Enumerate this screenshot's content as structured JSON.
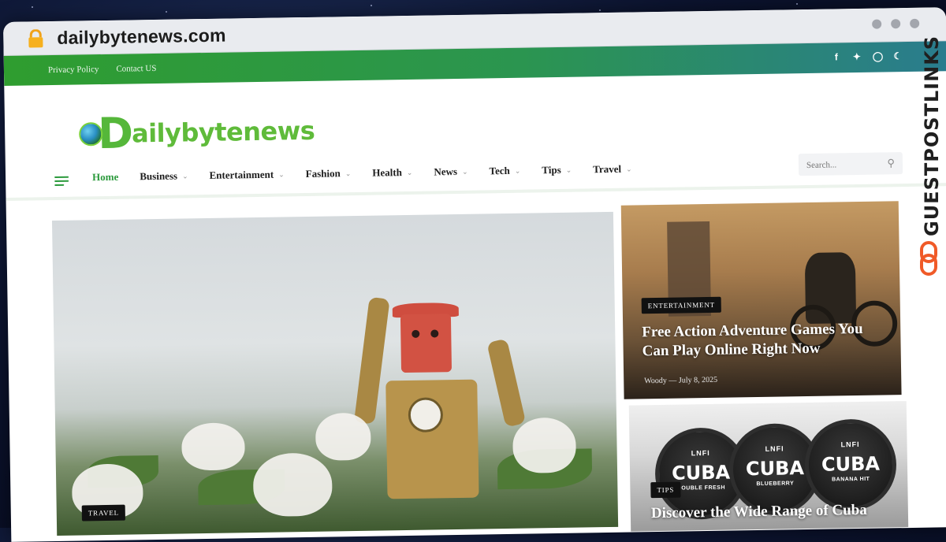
{
  "browser": {
    "url": "dailybytenews.com"
  },
  "topbar": {
    "links": [
      "Privacy Policy",
      "Contact US"
    ],
    "social_icons": [
      "facebook-icon",
      "twitter-icon",
      "instagram-icon",
      "moon-icon"
    ]
  },
  "site": {
    "logo_first_letter": "D",
    "logo_rest": "ailybytenews"
  },
  "nav": {
    "items": [
      {
        "label": "Home",
        "active": true,
        "dropdown": false
      },
      {
        "label": "Business",
        "dropdown": true
      },
      {
        "label": "Entertainment",
        "dropdown": true
      },
      {
        "label": "Fashion",
        "dropdown": true
      },
      {
        "label": "Health",
        "dropdown": true
      },
      {
        "label": "News",
        "dropdown": true
      },
      {
        "label": "Tech",
        "dropdown": true
      },
      {
        "label": "Tips",
        "dropdown": true
      },
      {
        "label": "Travel",
        "dropdown": true
      }
    ],
    "search_placeholder": "Search..."
  },
  "hero": {
    "category": "TRAVEL"
  },
  "cards": [
    {
      "category": "ENTERTAINMENT",
      "title": "Free Action Adventure Games You Can Play Online Right Now",
      "author": "Woody",
      "date": "July 8, 2025"
    },
    {
      "category": "TIPS",
      "title": "Discover the Wide Range of Cuba",
      "tins": [
        {
          "brand": "LNFI",
          "name": "CUBA",
          "flavor": "DOUBLE FRESH"
        },
        {
          "brand": "LNFI",
          "name": "CUBA",
          "flavor": "BLUEBERRY"
        },
        {
          "brand": "LNFI",
          "name": "CUBA",
          "flavor": "BANANA HIT"
        }
      ]
    }
  ],
  "watermark": {
    "text": "GUESTPOSTLINKS"
  },
  "colors": {
    "brand_green": "#2b9a3c",
    "topbar_gradient_start": "#2f9d2f",
    "topbar_gradient_end": "#2a7c8e",
    "logo_green": "#55b73a",
    "watermark_orange": "#f05a28"
  }
}
